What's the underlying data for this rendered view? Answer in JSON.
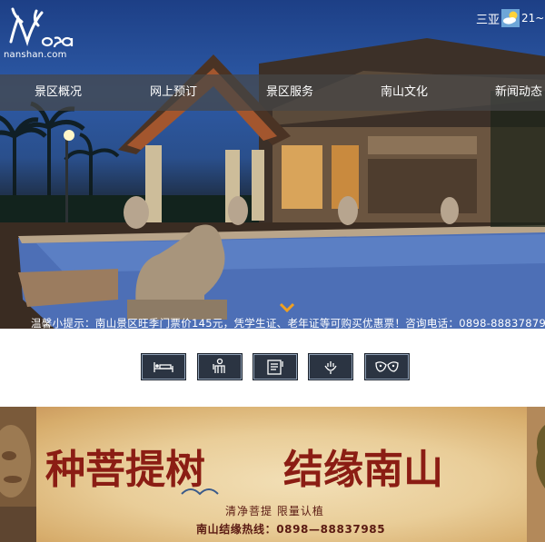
{
  "header": {
    "logo_sub": "nanshan.com",
    "weather": {
      "city": "三亚",
      "temperature": "21~",
      "icon": "partly-cloudy-icon"
    }
  },
  "nav": {
    "items": [
      {
        "label": "景区概况"
      },
      {
        "label": "网上预订"
      },
      {
        "label": "景区服务"
      },
      {
        "label": "南山文化"
      },
      {
        "label": "新闻动态"
      }
    ]
  },
  "notice": {
    "text": "温馨小提示：南山景区旺季门票价145元，凭学生证、老年证等可购买优惠票！咨询电话：0898-88837879"
  },
  "services": [
    {
      "icon": "hotel-bed-icon"
    },
    {
      "icon": "guide-person-icon"
    },
    {
      "icon": "ticket-document-icon"
    },
    {
      "icon": "temple-incense-icon"
    },
    {
      "icon": "mask-culture-icon"
    }
  ],
  "banner": {
    "slogan_left": "种菩提树",
    "slogan_right": "结缘南山",
    "tagline": "清净菩提    限量认植",
    "hotline": "南山结缘热线：0898—88837985"
  },
  "colors": {
    "nav_bg": "#464646",
    "service_bg": "#2b3442",
    "banner_text": "#5a1a12",
    "slogan_red": "#8b1d14"
  }
}
